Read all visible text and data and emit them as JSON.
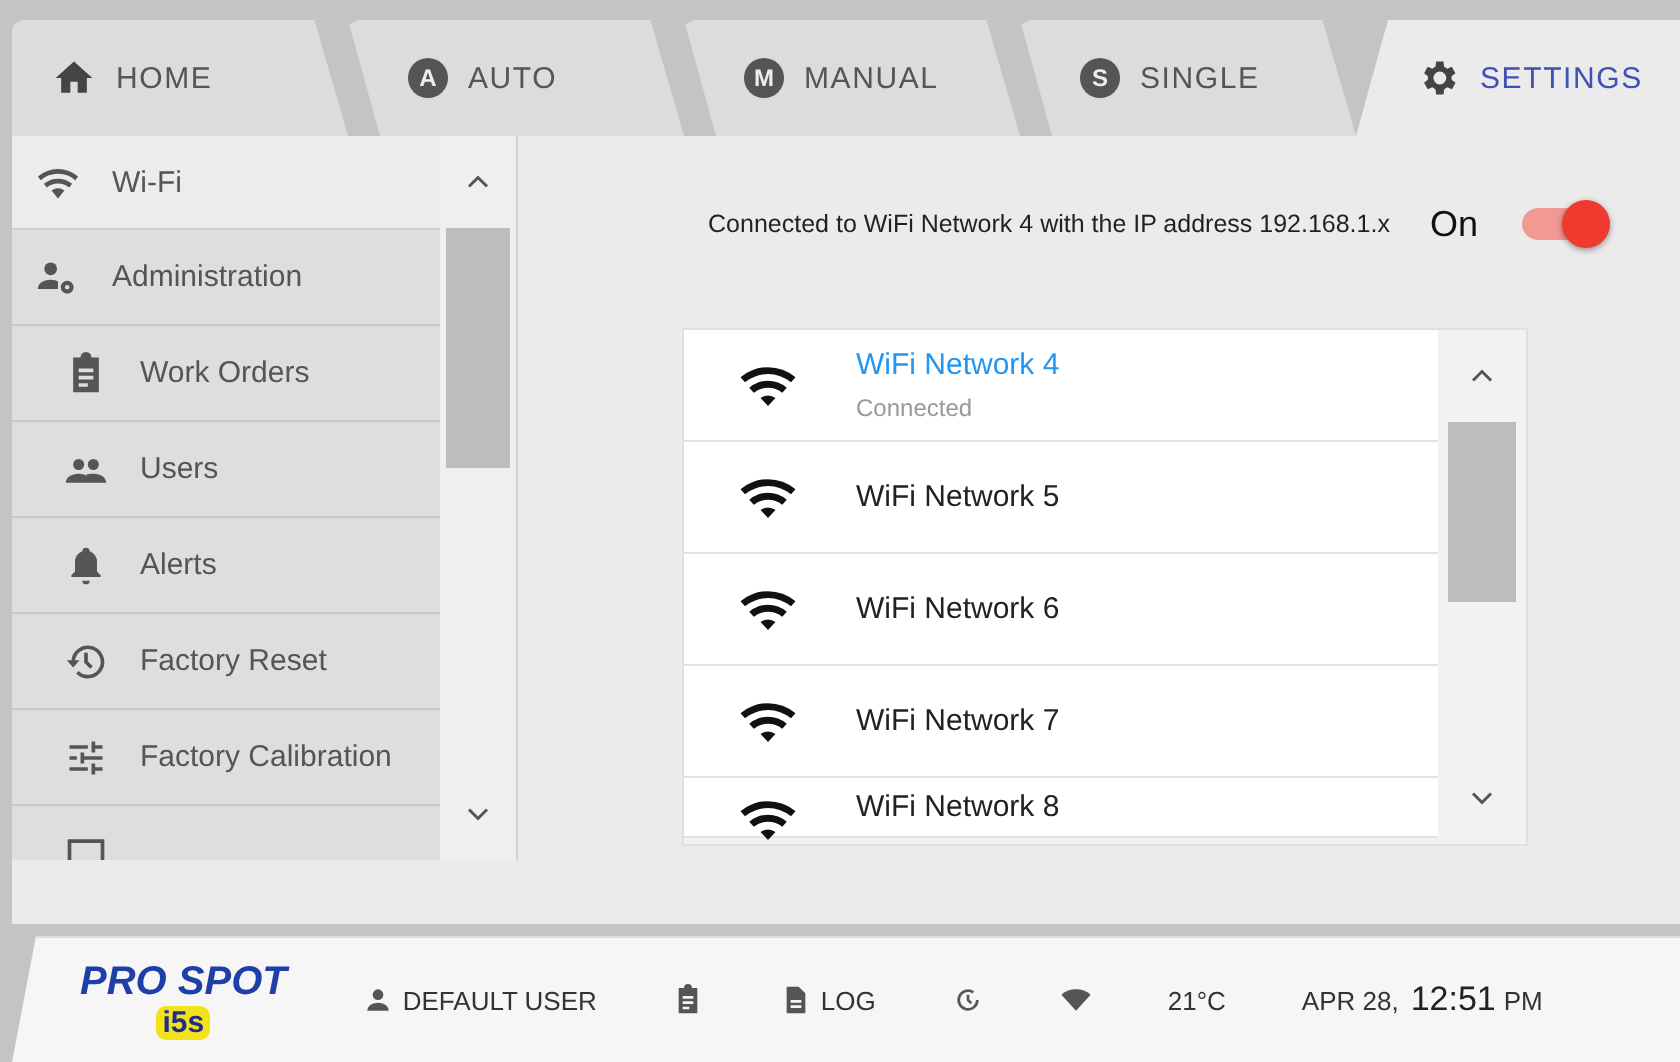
{
  "tabs": [
    {
      "label": "HOME",
      "selected": false
    },
    {
      "label": "AUTO",
      "letter": "A",
      "selected": false
    },
    {
      "label": "MANUAL",
      "letter": "M",
      "selected": false
    },
    {
      "label": "SINGLE",
      "letter": "S",
      "selected": false
    },
    {
      "label": "SETTINGS",
      "selected": true
    }
  ],
  "sidebar": {
    "items": [
      {
        "label": "Wi-Fi",
        "selected": true
      },
      {
        "label": "Administration",
        "selected": false,
        "children": [
          {
            "label": "Work Orders",
            "selected": false
          },
          {
            "label": "Users",
            "selected": false
          },
          {
            "label": "Alerts",
            "selected": false
          },
          {
            "label": "Factory Reset",
            "selected": false
          },
          {
            "label": "Factory Calibration",
            "selected": false
          }
        ]
      }
    ]
  },
  "wifi": {
    "status": "Connected to WiFi Network 4 with the IP address 192.168.1.x",
    "toggle_label": "On",
    "on": true,
    "networks": [
      {
        "name": "WiFi Network 4",
        "detail": "Connected",
        "connected": true
      },
      {
        "name": "WiFi Network 5",
        "connected": false
      },
      {
        "name": "WiFi Network 6",
        "connected": false
      },
      {
        "name": "WiFi Network 7",
        "connected": false
      },
      {
        "name": "WiFi Network 8",
        "connected": false
      }
    ]
  },
  "status_bar": {
    "logo": "PRO SPOT",
    "logo_sub": "i5s",
    "user": "DEFAULT USER",
    "log": "LOG",
    "temperature": "21°C",
    "date": "APR 28,",
    "time": "12:51",
    "ampm": "PM"
  }
}
